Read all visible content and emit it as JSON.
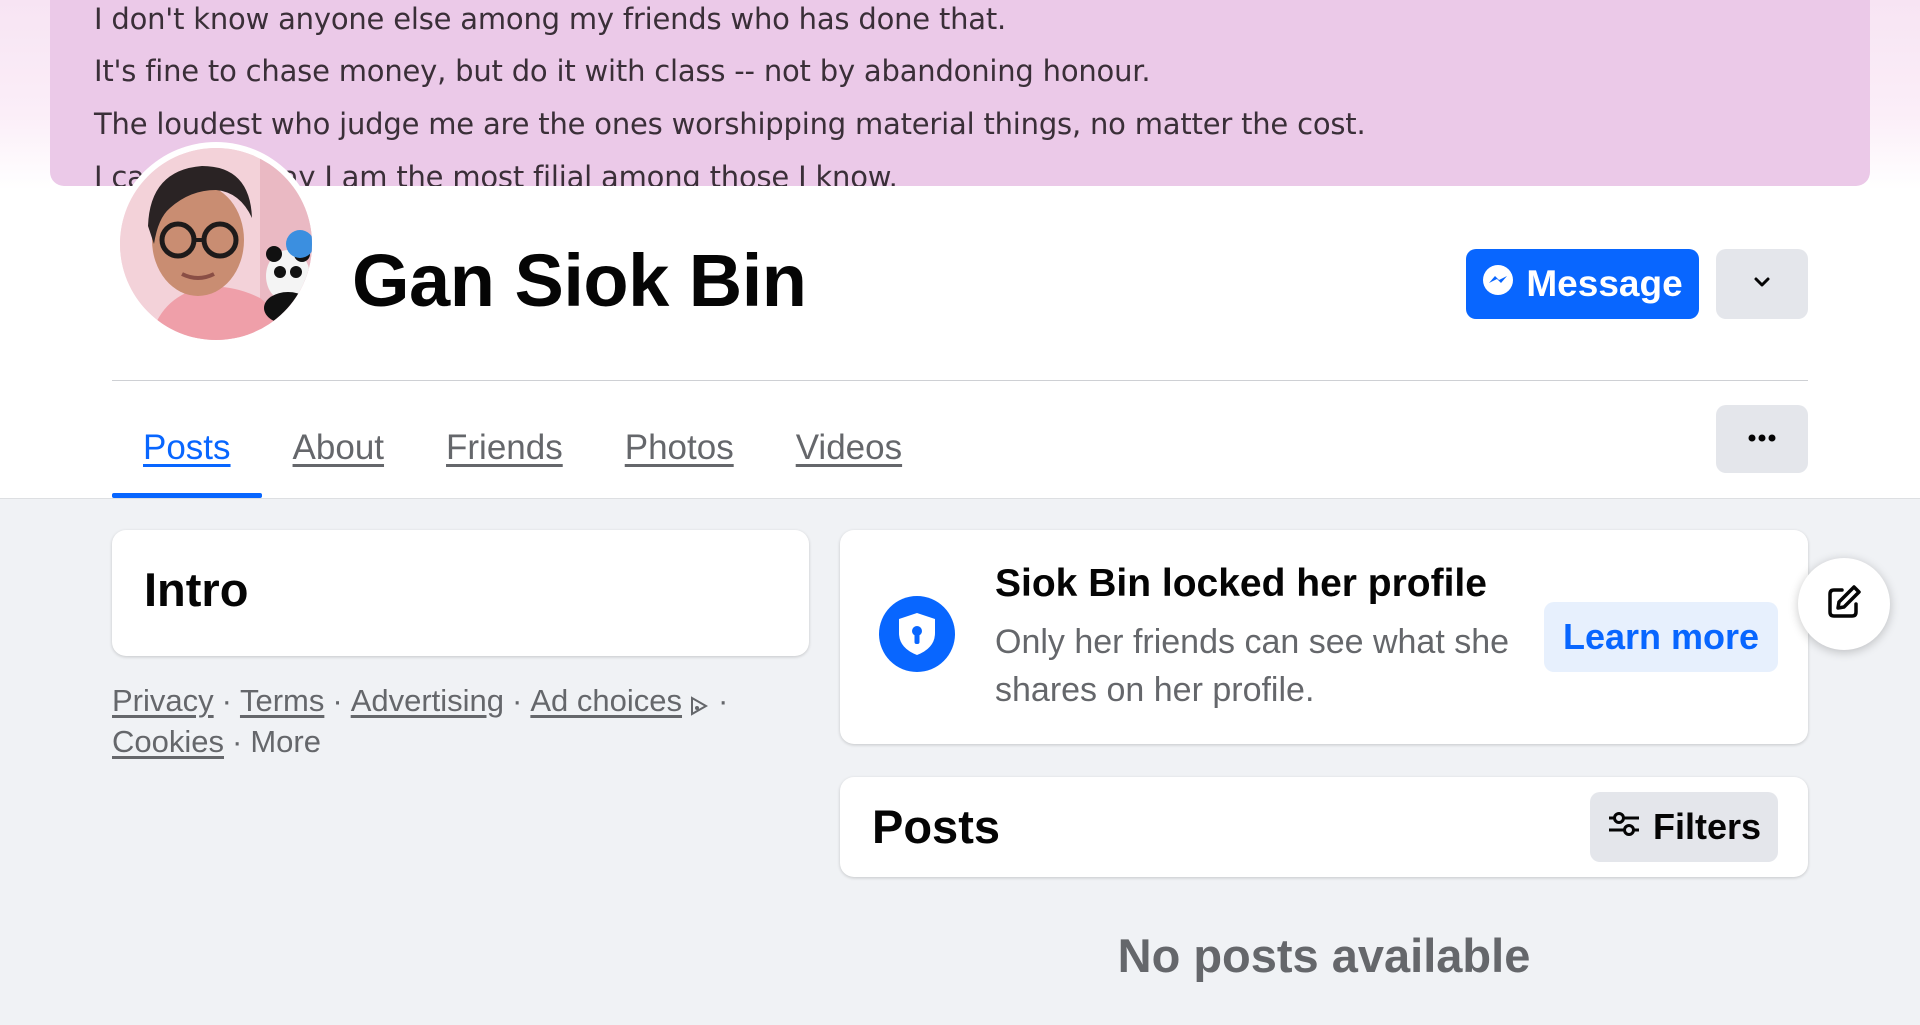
{
  "cover": {
    "lines": [
      "I don't know anyone else among my friends who has done that.",
      "It's fine to chase money, but do it with class -- not by abandoning honour.",
      "The loudest who judge me are the ones worshipping material things, no matter the cost.",
      "I can safely say I am the most filial among those I know."
    ],
    "background": "#ebc9e8"
  },
  "profile": {
    "name": "Gan Siok Bin",
    "message_label": "Message",
    "avatar_icon": "profile-photo"
  },
  "tabs": [
    "Posts",
    "About",
    "Friends",
    "Photos",
    "Videos"
  ],
  "active_tab": "Posts",
  "intro": {
    "title": "Intro"
  },
  "footer": {
    "privacy": "Privacy",
    "terms": "Terms",
    "advertising": "Advertising",
    "ad_choices": "Ad choices",
    "cookies": "Cookies",
    "more": "More"
  },
  "lock_notice": {
    "title": "Siok Bin locked her profile",
    "description": "Only her friends can see what she shares on her profile.",
    "learn_more": "Learn more"
  },
  "posts": {
    "title": "Posts",
    "filters_label": "Filters",
    "empty_text": "No posts available"
  },
  "colors": {
    "accent": "#0866ff",
    "page_bg": "#f0f2f5",
    "secondary_text": "#65676b",
    "button_grey": "#e4e6eb"
  }
}
